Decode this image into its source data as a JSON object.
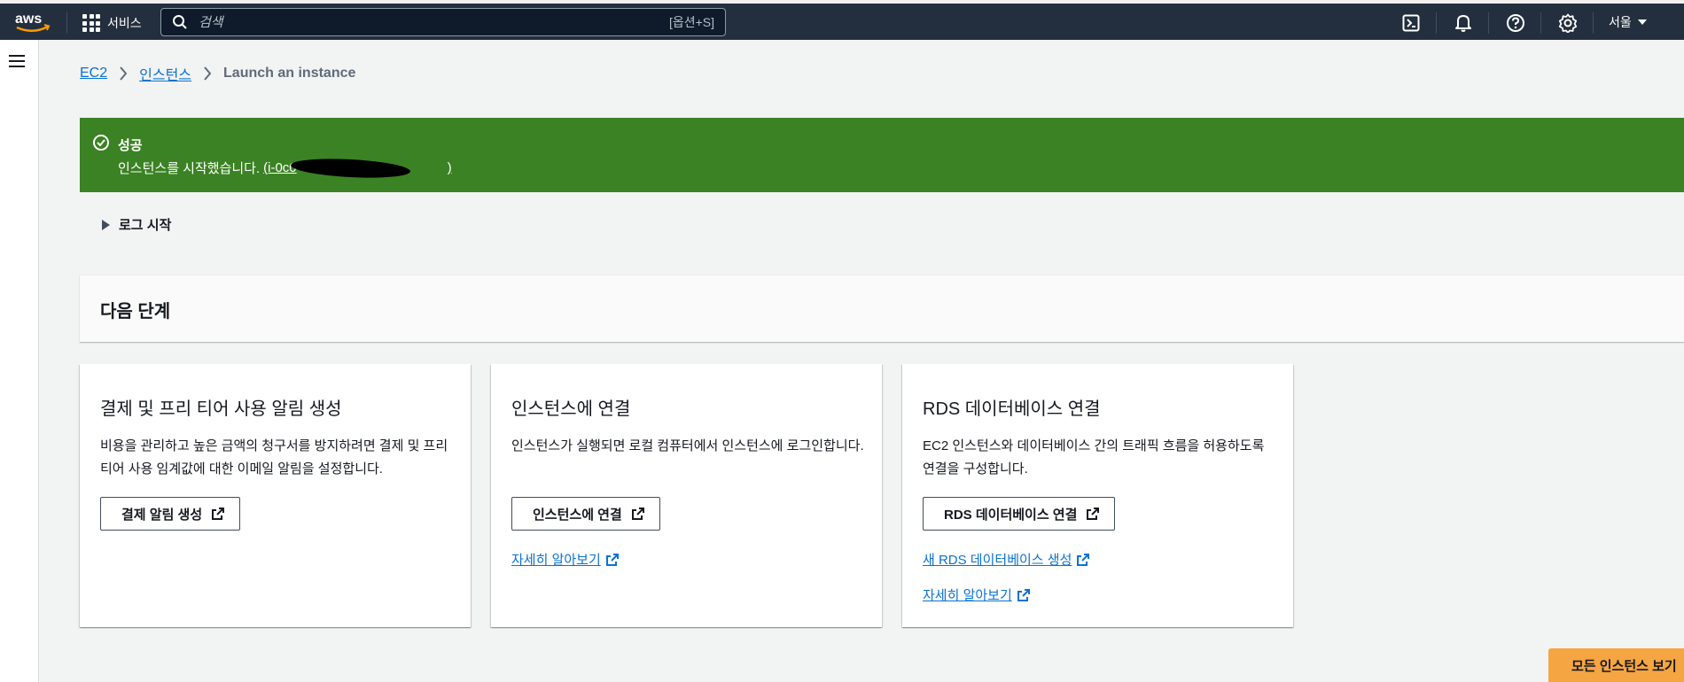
{
  "nav": {
    "logo_text": "aws",
    "services_label": "서비스",
    "search_placeholder": "검색",
    "search_shortcut": "[옵션+S]",
    "region_label": "서울"
  },
  "breadcrumb": {
    "items": [
      "EC2",
      "인스턴스"
    ],
    "current": "Launch an instance"
  },
  "flash": {
    "title": "성공",
    "message": "인스턴스를 시작했습니다.",
    "instance_id_open": "(i-0c0",
    "instance_id_close": ")"
  },
  "logs": {
    "label": "로그 시작"
  },
  "next_steps": {
    "title": "다음 단계",
    "cards": [
      {
        "title": "결제 및 프리 티어 사용 알림 생성",
        "description": "비용을 관리하고 높은 금액의 청구서를 방지하려면 결제 및 프리 티어 사용 임계값에 대한 이메일 알림을 설정합니다.",
        "button": "결제 알림 생성"
      },
      {
        "title": "인스턴스에 연결",
        "description": "인스턴스가 실행되면 로컬 컴퓨터에서 인스턴스에 로그인합니다.",
        "button": "인스턴스에 연결",
        "links": [
          "자세히 알아보기"
        ]
      },
      {
        "title": "RDS 데이터베이스 연결",
        "description": "EC2 인스턴스와 데이터베이스 간의 트래픽 흐름을 허용하도록 연결을 구성합니다.",
        "button": "RDS 데이터베이스 연결",
        "links": [
          "새 RDS 데이터베이스 생성",
          "자세히 알아보기"
        ]
      }
    ]
  },
  "view_all_button": "모든 인스턴스 보기",
  "colors": {
    "nav_bg": "#232f3e",
    "success_green": "#3b8224",
    "link_blue": "#0972d3",
    "primary_orange": "#f5a542"
  }
}
